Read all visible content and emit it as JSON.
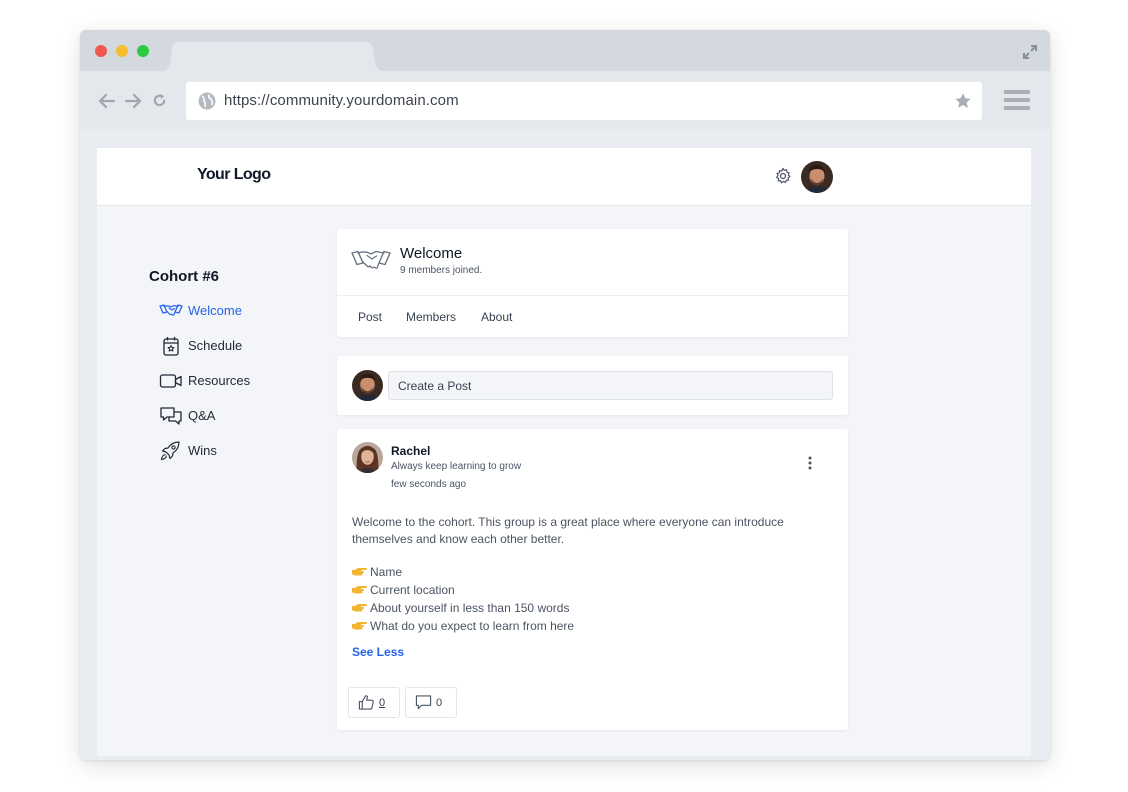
{
  "browser": {
    "url": "https://community.yourdomain.com"
  },
  "header": {
    "logo": "Your Logo"
  },
  "sidebar": {
    "title": "Cohort #6",
    "items": [
      {
        "label": "Welcome",
        "icon": "handshake-icon",
        "active": true
      },
      {
        "label": "Schedule",
        "icon": "calendar-icon",
        "active": false
      },
      {
        "label": "Resources",
        "icon": "video-icon",
        "active": false
      },
      {
        "label": "Q&A",
        "icon": "chat-icon",
        "active": false
      },
      {
        "label": "Wins",
        "icon": "rocket-icon",
        "active": false
      }
    ]
  },
  "group": {
    "title": "Welcome",
    "subtitle": "9 members joined.",
    "tabs": [
      "Post",
      "Members",
      "About"
    ]
  },
  "composer": {
    "placeholder": "Create a Post"
  },
  "post": {
    "author": "Rachel",
    "tagline": "Always keep learning to grow",
    "time": "few seconds ago",
    "body": "Welcome to the cohort. This group is a great place where everyone can introduce themselves and know each other better.",
    "bullets": [
      "Name",
      "Current location",
      "About yourself in less than 150 words",
      "What do you expect to learn from here"
    ],
    "see_less": "See Less",
    "likes": "0",
    "comments": "0"
  },
  "colors": {
    "accent": "#2563eb",
    "page_bg": "#f3f5f8",
    "card_bg": "#ffffff",
    "emoji": "#f2b531"
  }
}
